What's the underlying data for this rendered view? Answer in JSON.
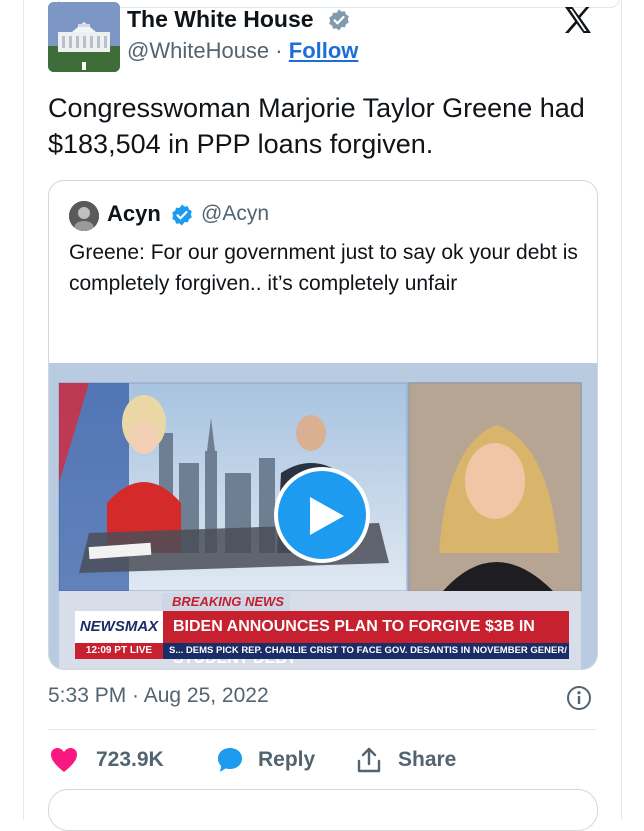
{
  "author": {
    "name": "The White House",
    "handle": "@WhiteHouse",
    "separator": "·",
    "follow_label": "Follow"
  },
  "tweet": {
    "text": "Congresswoman Marjorie Taylor Greene had $183,504 in PPP loans forgiven.",
    "timestamp": "5:33 PM · Aug 25, 2022"
  },
  "quoted": {
    "name": "Acyn",
    "handle": "@Acyn",
    "text": "Greene: For our government just to say ok your debt is completely forgiven.. it’s completely unfair"
  },
  "video": {
    "breaking_label": "BREAKING NEWS",
    "network": "NEWSMAX",
    "headline": "BIDEN ANNOUNCES PLAN TO FORGIVE $3B IN STUDENT DEBT",
    "time_live": "12:09 PT  LIVE",
    "ticker": "S...     DEMS PICK REP. CHARLIE CRIST TO FACE GOV. DESANTIS IN NOVEMBER GENER/"
  },
  "actions": {
    "likes": "723.9K",
    "reply_label": "Reply",
    "share_label": "Share"
  },
  "colors": {
    "accent_blue": "#1d9bf0",
    "like_pink": "#f91880",
    "text_gray": "#536471",
    "newsmax_red": "#c7202f",
    "newsmax_navy": "#1b2d66"
  },
  "icons": {
    "verified_gray": "gray-verified-badge-icon",
    "verified_blue": "blue-verified-badge-icon",
    "x_logo": "x-logo-icon",
    "play": "play-icon",
    "info": "info-icon",
    "like": "heart-icon",
    "reply": "speech-bubble-icon",
    "share": "share-upload-icon"
  }
}
